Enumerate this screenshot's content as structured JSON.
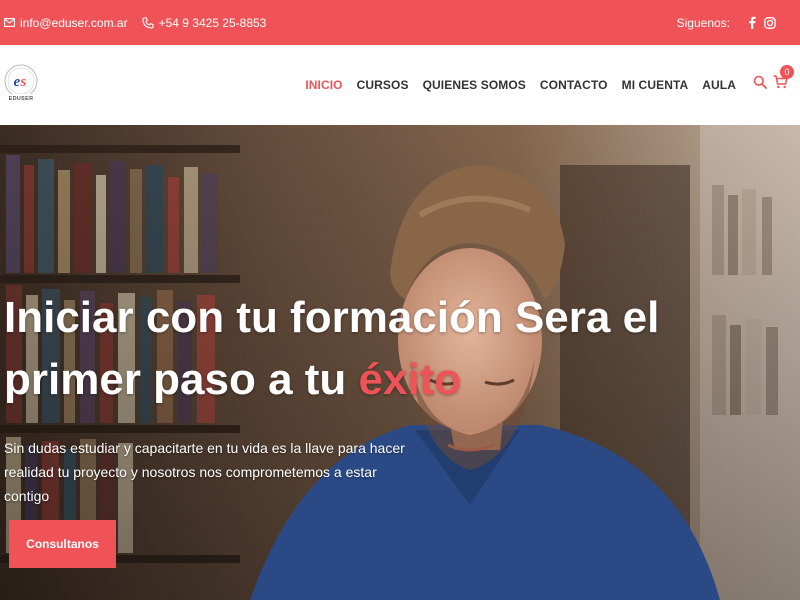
{
  "colors": {
    "accent": "#ef5357",
    "nav_text": "#333333",
    "white": "#ffffff"
  },
  "topbar": {
    "email": "info@eduser.com.ar",
    "phone": "+54 9 3425 25-8853",
    "social_label": "Siguenos:",
    "social_icons": [
      "facebook-icon",
      "instagram-icon"
    ]
  },
  "header": {
    "logo_text": "EDUSER",
    "nav": [
      {
        "label": "INICIO",
        "active": true
      },
      {
        "label": "CURSOS",
        "active": false
      },
      {
        "label": "QUIENES SOMOS",
        "active": false
      },
      {
        "label": "CONTACTO",
        "active": false
      },
      {
        "label": "MI CUENTA",
        "active": false
      },
      {
        "label": "AULA",
        "active": false
      }
    ],
    "cart_count": "0",
    "icons": [
      "search-icon",
      "cart-icon"
    ]
  },
  "hero": {
    "title_main": "Iniciar con tu formación Sera el primer paso a tu",
    "title_accent": "éxito",
    "description": "Sin dudas estudiar y capacitarte en tu vida es la llave para hacer realidad tu proyecto y nosotros nos comprometemos a estar contigo",
    "button_label": "Consultanos"
  }
}
